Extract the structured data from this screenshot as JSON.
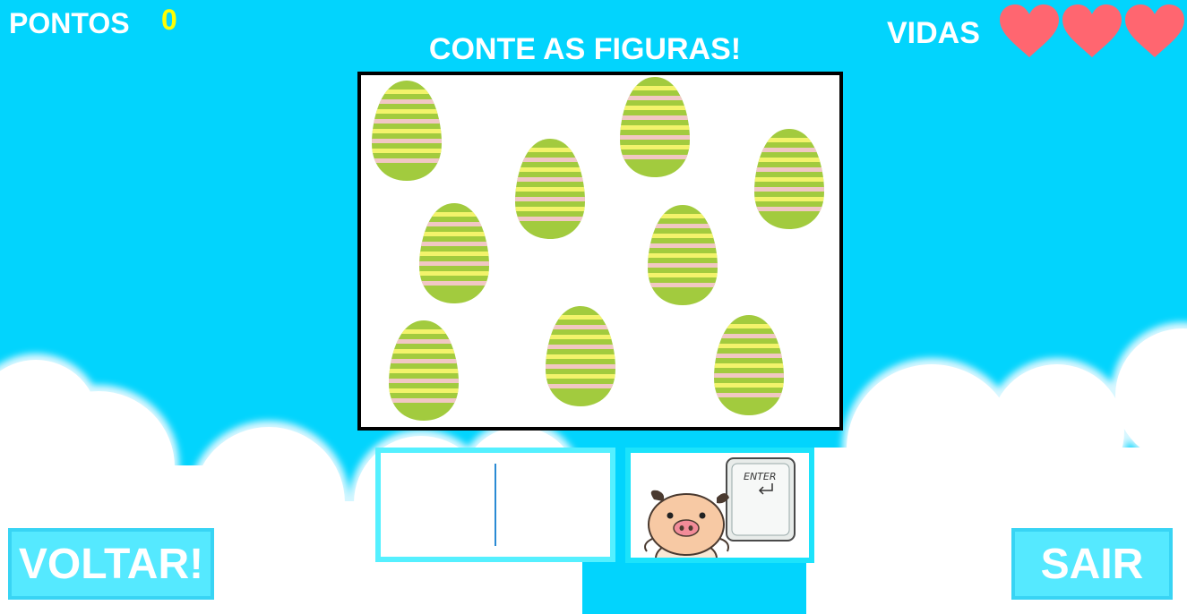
{
  "hud": {
    "score_label": "PONTOS",
    "score_value": "0",
    "lives_label": "VIDAS",
    "lives": 3
  },
  "game": {
    "instruction": "CONTE AS FIGURAS!",
    "figure": "striped-easter-egg",
    "figure_count": 9,
    "answer_value": "",
    "enter_key_label": "ENTER"
  },
  "buttons": {
    "back_label": "VOLTAR!",
    "exit_label": "SAIR"
  },
  "colors": {
    "sky": "#02d4fd",
    "score_value": "#ffff00",
    "heart": "#ff6670",
    "egg_green": "#a2cb3e",
    "egg_yellow": "#f3f36b",
    "egg_pink": "#f1c7c4",
    "button": "#55e9ff"
  }
}
